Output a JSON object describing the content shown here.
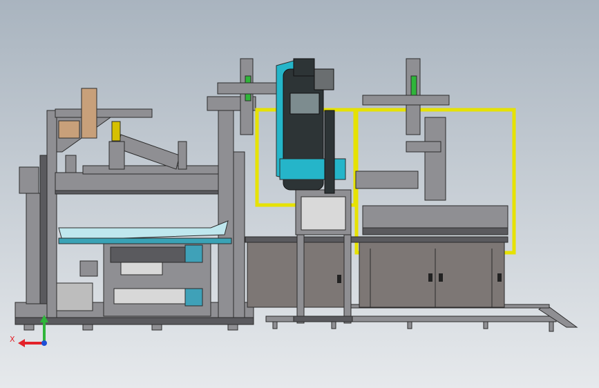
{
  "viewport": {
    "background_top": "#a9b4bf",
    "background_bottom": "#e6e9ec"
  },
  "model": {
    "frame_color": "#8f8f93",
    "frame_dark": "#5a5a5e",
    "cabinet_color": "#7d7775",
    "guard_color": "#e6e200",
    "robot_color": "#25b5c9",
    "robot_dark": "#2d3436",
    "outline_color": "#2b2b2b"
  },
  "triad": {
    "x_label": "X",
    "x_color": "#e3222a",
    "y_color": "#2fb53a",
    "z_color": "#1f4fd6"
  }
}
